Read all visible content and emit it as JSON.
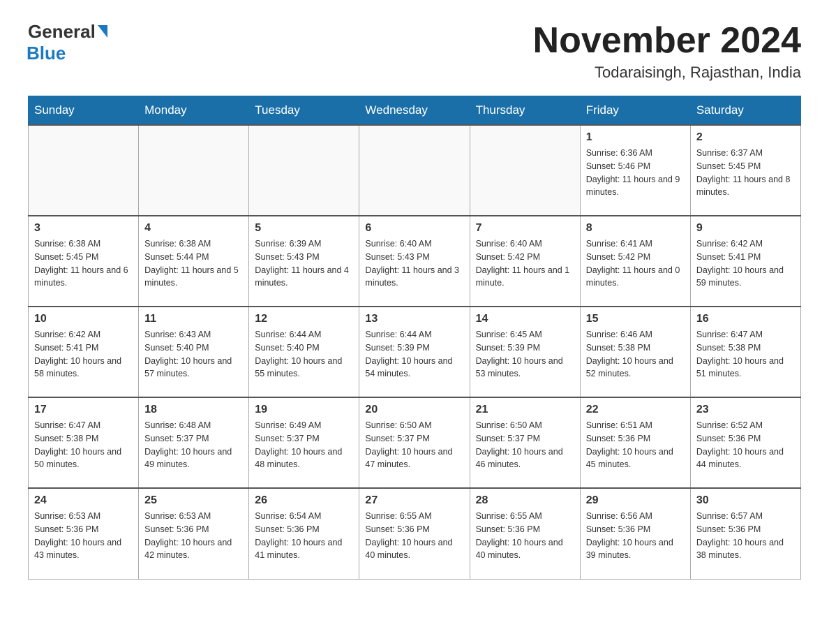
{
  "header": {
    "logo_general": "General",
    "logo_blue": "Blue",
    "month_title": "November 2024",
    "location": "Todaraisingh, Rajasthan, India"
  },
  "weekdays": [
    "Sunday",
    "Monday",
    "Tuesday",
    "Wednesday",
    "Thursday",
    "Friday",
    "Saturday"
  ],
  "weeks": [
    [
      {
        "day": "",
        "info": ""
      },
      {
        "day": "",
        "info": ""
      },
      {
        "day": "",
        "info": ""
      },
      {
        "day": "",
        "info": ""
      },
      {
        "day": "",
        "info": ""
      },
      {
        "day": "1",
        "info": "Sunrise: 6:36 AM\nSunset: 5:46 PM\nDaylight: 11 hours and 9 minutes."
      },
      {
        "day": "2",
        "info": "Sunrise: 6:37 AM\nSunset: 5:45 PM\nDaylight: 11 hours and 8 minutes."
      }
    ],
    [
      {
        "day": "3",
        "info": "Sunrise: 6:38 AM\nSunset: 5:45 PM\nDaylight: 11 hours and 6 minutes."
      },
      {
        "day": "4",
        "info": "Sunrise: 6:38 AM\nSunset: 5:44 PM\nDaylight: 11 hours and 5 minutes."
      },
      {
        "day": "5",
        "info": "Sunrise: 6:39 AM\nSunset: 5:43 PM\nDaylight: 11 hours and 4 minutes."
      },
      {
        "day": "6",
        "info": "Sunrise: 6:40 AM\nSunset: 5:43 PM\nDaylight: 11 hours and 3 minutes."
      },
      {
        "day": "7",
        "info": "Sunrise: 6:40 AM\nSunset: 5:42 PM\nDaylight: 11 hours and 1 minute."
      },
      {
        "day": "8",
        "info": "Sunrise: 6:41 AM\nSunset: 5:42 PM\nDaylight: 11 hours and 0 minutes."
      },
      {
        "day": "9",
        "info": "Sunrise: 6:42 AM\nSunset: 5:41 PM\nDaylight: 10 hours and 59 minutes."
      }
    ],
    [
      {
        "day": "10",
        "info": "Sunrise: 6:42 AM\nSunset: 5:41 PM\nDaylight: 10 hours and 58 minutes."
      },
      {
        "day": "11",
        "info": "Sunrise: 6:43 AM\nSunset: 5:40 PM\nDaylight: 10 hours and 57 minutes."
      },
      {
        "day": "12",
        "info": "Sunrise: 6:44 AM\nSunset: 5:40 PM\nDaylight: 10 hours and 55 minutes."
      },
      {
        "day": "13",
        "info": "Sunrise: 6:44 AM\nSunset: 5:39 PM\nDaylight: 10 hours and 54 minutes."
      },
      {
        "day": "14",
        "info": "Sunrise: 6:45 AM\nSunset: 5:39 PM\nDaylight: 10 hours and 53 minutes."
      },
      {
        "day": "15",
        "info": "Sunrise: 6:46 AM\nSunset: 5:38 PM\nDaylight: 10 hours and 52 minutes."
      },
      {
        "day": "16",
        "info": "Sunrise: 6:47 AM\nSunset: 5:38 PM\nDaylight: 10 hours and 51 minutes."
      }
    ],
    [
      {
        "day": "17",
        "info": "Sunrise: 6:47 AM\nSunset: 5:38 PM\nDaylight: 10 hours and 50 minutes."
      },
      {
        "day": "18",
        "info": "Sunrise: 6:48 AM\nSunset: 5:37 PM\nDaylight: 10 hours and 49 minutes."
      },
      {
        "day": "19",
        "info": "Sunrise: 6:49 AM\nSunset: 5:37 PM\nDaylight: 10 hours and 48 minutes."
      },
      {
        "day": "20",
        "info": "Sunrise: 6:50 AM\nSunset: 5:37 PM\nDaylight: 10 hours and 47 minutes."
      },
      {
        "day": "21",
        "info": "Sunrise: 6:50 AM\nSunset: 5:37 PM\nDaylight: 10 hours and 46 minutes."
      },
      {
        "day": "22",
        "info": "Sunrise: 6:51 AM\nSunset: 5:36 PM\nDaylight: 10 hours and 45 minutes."
      },
      {
        "day": "23",
        "info": "Sunrise: 6:52 AM\nSunset: 5:36 PM\nDaylight: 10 hours and 44 minutes."
      }
    ],
    [
      {
        "day": "24",
        "info": "Sunrise: 6:53 AM\nSunset: 5:36 PM\nDaylight: 10 hours and 43 minutes."
      },
      {
        "day": "25",
        "info": "Sunrise: 6:53 AM\nSunset: 5:36 PM\nDaylight: 10 hours and 42 minutes."
      },
      {
        "day": "26",
        "info": "Sunrise: 6:54 AM\nSunset: 5:36 PM\nDaylight: 10 hours and 41 minutes."
      },
      {
        "day": "27",
        "info": "Sunrise: 6:55 AM\nSunset: 5:36 PM\nDaylight: 10 hours and 40 minutes."
      },
      {
        "day": "28",
        "info": "Sunrise: 6:55 AM\nSunset: 5:36 PM\nDaylight: 10 hours and 40 minutes."
      },
      {
        "day": "29",
        "info": "Sunrise: 6:56 AM\nSunset: 5:36 PM\nDaylight: 10 hours and 39 minutes."
      },
      {
        "day": "30",
        "info": "Sunrise: 6:57 AM\nSunset: 5:36 PM\nDaylight: 10 hours and 38 minutes."
      }
    ]
  ]
}
